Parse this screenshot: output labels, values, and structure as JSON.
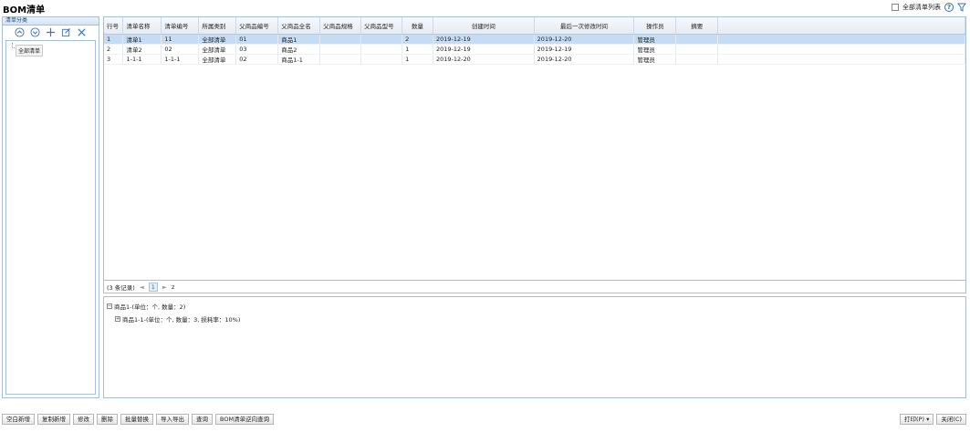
{
  "page": {
    "title": "BOM清单"
  },
  "top_right": {
    "all_list_label": "全部清单列表",
    "help_symbol": "?"
  },
  "left_panel": {
    "header": "清单分类",
    "tree": {
      "root": "全部清单"
    }
  },
  "grid": {
    "columns": [
      "行号",
      "清单名称",
      "清单编号",
      "所属类别",
      "父商品编号",
      "父商品全名",
      "父商品规格",
      "父商品型号",
      "数量",
      "创建时间",
      "最后一次修改时间",
      "操作员",
      "摘要"
    ],
    "rows": [
      [
        "1",
        "清单1",
        "11",
        "全部清单",
        "01",
        "商品1",
        "",
        "",
        "2",
        "2019-12-19",
        "2019-12-20",
        "管理员",
        ""
      ],
      [
        "2",
        "清单2",
        "02",
        "全部清单",
        "03",
        "商品2",
        "",
        "",
        "1",
        "2019-12-19",
        "2019-12-19",
        "管理员",
        ""
      ],
      [
        "3",
        "1-1-1",
        "1-1-1",
        "全部清单",
        "02",
        "商品1-1",
        "",
        "",
        "1",
        "2019-12-20",
        "2019-12-20",
        "管理员",
        ""
      ]
    ],
    "selected_row": 0
  },
  "pager": {
    "records": "(3 条记录)",
    "prev": "◄",
    "current": "1",
    "next": "►",
    "refresh": "z"
  },
  "detail": {
    "lines": [
      {
        "expander": "−",
        "text": "商品1-(单位：个, 数量：2)"
      },
      {
        "expander": "+",
        "text": "商品1-1-(单位：个, 数量：3, 损耗率：10%)"
      }
    ]
  },
  "toolbar": {
    "buttons": [
      "空白新增",
      "复制新增",
      "修改",
      "删除",
      "批量替换",
      "导入导出",
      "查询",
      "BOM清单逆向查询"
    ],
    "print": "打印(P) ▾",
    "close": "关闭(C)"
  },
  "colors": {
    "accent": "#3b74b9",
    "selected_row": "#c5dcf4",
    "border": "#a9bfd6"
  }
}
